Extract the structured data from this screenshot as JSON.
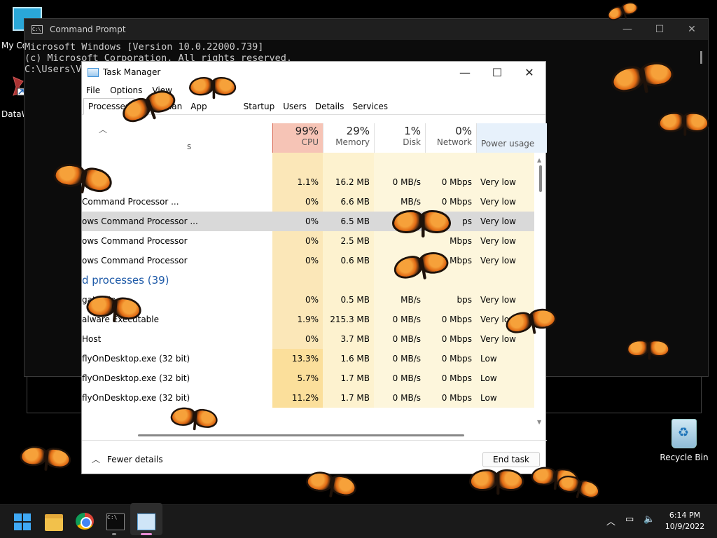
{
  "desktop": {
    "icons": [
      {
        "label": "My Co"
      },
      {
        "label": "DataW"
      },
      {
        "label": "Recycle Bin"
      }
    ]
  },
  "cmd": {
    "title": "Command Prompt",
    "lines": [
      "Microsoft Windows [Version 10.0.22000.739]",
      "(c) Microsoft Corporation. All rights reserved.",
      "",
      "C:\\Users\\V"
    ]
  },
  "taskmanager": {
    "title": "Task Manager",
    "menu": [
      "File",
      "Options",
      "View"
    ],
    "tabs": [
      "Processes",
      "Performan",
      "App",
      "Startup",
      "Users",
      "Details",
      "Services"
    ],
    "header": {
      "name_frag": "s",
      "cpu": {
        "pct": "99%",
        "label": "CPU"
      },
      "memory": {
        "pct": "29%",
        "label": "Memory"
      },
      "disk": {
        "pct": "1%",
        "label": "Disk"
      },
      "network": {
        "pct": "0%",
        "label": "Network"
      },
      "power": {
        "label": "Power usage"
      }
    },
    "rows": [
      {
        "name": "",
        "cpu": "",
        "mem": "",
        "disk": "",
        "net": "",
        "power": ""
      },
      {
        "name": "Mana",
        "cpu": "1.1%",
        "mem": "16.2 MB",
        "disk": "0 MB/s",
        "net": "0 Mbps",
        "power": "Very low"
      },
      {
        "name": "Command Processor ...",
        "cpu": "0%",
        "mem": "6.6 MB",
        "disk": "MB/s",
        "net": "0 Mbps",
        "power": "Very low"
      },
      {
        "name": "ows Command Processor ...",
        "cpu": "0%",
        "mem": "6.5 MB",
        "disk": "",
        "net": "ps",
        "power": "Very low"
      },
      {
        "name": "ows Command Processor",
        "cpu": "0%",
        "mem": "2.5 MB",
        "disk": "",
        "net": "Mbps",
        "power": "Very low"
      },
      {
        "name": "ows Command Processor",
        "cpu": "0%",
        "mem": "0.6 MB",
        "disk": "",
        "net": "Mbps",
        "power": "Very low"
      },
      {
        "name": "d processes (39)",
        "cpu": "",
        "mem": "",
        "disk": "",
        "net": "",
        "power": ""
      },
      {
        "name": "gatorHo",
        "cpu": "0%",
        "mem": "0.5 MB",
        "disk": "MB/s",
        "net": "bps",
        "power": "Very low"
      },
      {
        "name": "alware Executable",
        "cpu": "1.9%",
        "mem": "215.3 MB",
        "disk": "0 MB/s",
        "net": "0 Mbps",
        "power": "Very low"
      },
      {
        "name": "Host",
        "cpu": "0%",
        "mem": "3.7 MB",
        "disk": "0 MB/s",
        "net": "0 Mbps",
        "power": "Very low"
      },
      {
        "name": "flyOnDesktop.exe (32 bit)",
        "cpu": "13.3%",
        "mem": "1.6 MB",
        "disk": "0 MB/s",
        "net": "0 Mbps",
        "power": "Low"
      },
      {
        "name": "flyOnDesktop.exe (32 bit)",
        "cpu": "5.7%",
        "mem": "1.7 MB",
        "disk": "0 MB/s",
        "net": "0 Mbps",
        "power": "Low"
      },
      {
        "name": "flyOnDesktop.exe (32 bit)",
        "cpu": "11.2%",
        "mem": "1.7 MB",
        "disk": "0 MB/s",
        "net": "0 Mbps",
        "power": "Low"
      }
    ],
    "footer": {
      "fewer": "Fewer details",
      "end": "End task"
    }
  },
  "taskbar": {
    "time": "6:14 PM",
    "date": "10/9/2022",
    "cmd_glyph": "C:\\"
  }
}
